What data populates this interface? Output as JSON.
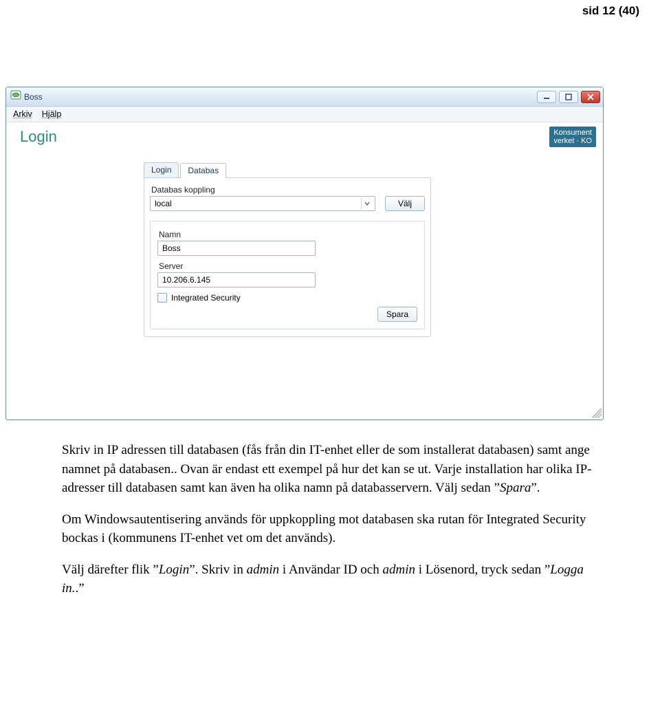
{
  "page_header": "sid 12 (40)",
  "window": {
    "title": "Boss",
    "menu": {
      "arkiv": "Arkiv",
      "hjalp": "Hjälp"
    },
    "login_heading": "Login",
    "badge_line1": "Konsument",
    "badge_line2": "verket · KO",
    "tabs": {
      "login": "Login",
      "databas": "Databas"
    },
    "panel": {
      "koppling_label": "Databas koppling",
      "dropdown_value": "local",
      "valj_button": "Välj",
      "namn_label": "Namn",
      "namn_value": "Boss",
      "server_label": "Server",
      "server_value": "10.206.6.145",
      "integrated_label": "Integrated Security",
      "spara_button": "Spara"
    }
  },
  "text": {
    "p1a": "Skriv in IP adressen till databasen (fås från din IT-enhet eller de som installerat databasen) samt ange namnet på databasen.. Ovan är endast ett exempel på hur det kan se ut. Varje installation har olika IP-adresser till databasen samt kan även ha olika namn på databasservern. Välj sedan ”",
    "p1b": "Spara",
    "p1c": "”.",
    "p2a": "Om Windowsautentisering används för uppkoppling mot databasen ska rutan för Integrated Security bockas i (kommunens IT-enhet vet om det används).",
    "p3a": "Välj därefter flik ”",
    "p3b": "Login",
    "p3c": "”. Skriv in ",
    "p3d": "admin",
    "p3e": " i Användar ID och ",
    "p3f": "admin",
    "p3g": " i Lösenord, tryck sedan ”",
    "p3h": "Logga in.",
    "p3i": ".”"
  }
}
